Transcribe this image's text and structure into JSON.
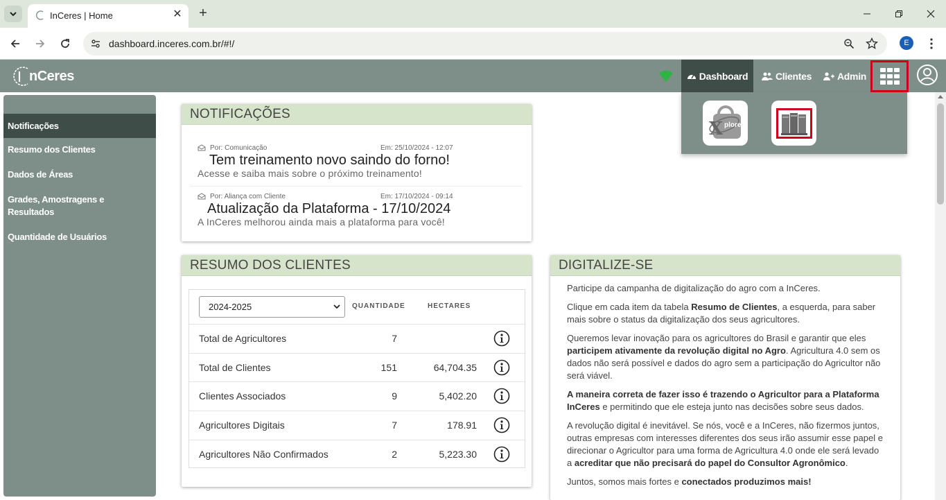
{
  "browser": {
    "tab_title": "InCeres | Home",
    "url": "dashboard.inceres.com.br/#!/",
    "profile_initial": "E"
  },
  "app": {
    "logo_text": "nCeres",
    "nav": {
      "dashboard": "Dashboard",
      "clientes": "Clientes",
      "admin": "Admin"
    },
    "apps": [
      "xplorer-app",
      "books-app"
    ],
    "xplorer_label": "plorer"
  },
  "sidebar": {
    "items": [
      {
        "label": "Notificações",
        "active": true
      },
      {
        "label": "Resumo dos Clientes"
      },
      {
        "label": "Dados de Áreas"
      },
      {
        "label": "Grades, Amostragens e Resultados"
      },
      {
        "label": "Quantidade de Usuários"
      }
    ]
  },
  "notifications": {
    "title": "NOTIFICAÇÕES",
    "items": [
      {
        "from": "Por: Comunicação",
        "date": "Em: 25/10/2024 - 12:07",
        "title": "Tem treinamento novo saindo do forno!",
        "desc": "Acesse e saiba mais sobre o próximo treinamento!"
      },
      {
        "from": "Por: Aliança com Cliente",
        "date": "Em: 17/10/2024 - 09:14",
        "title": "Atualização da Plataforma - 17/10/2024",
        "desc": "A InCeres melhorou ainda mais a plataforma para você!"
      }
    ]
  },
  "summary": {
    "title": "RESUMO DOS CLIENTES",
    "season": "2024-2025",
    "col_qty": "QUANTIDADE",
    "col_ha": "HECTARES",
    "rows": [
      {
        "label": "Total de Agricultores",
        "qty": "7",
        "ha": ""
      },
      {
        "label": "Total de Clientes",
        "qty": "151",
        "ha": "64,704.35"
      },
      {
        "label": "Clientes Associados",
        "qty": "9",
        "ha": "5,402.20"
      },
      {
        "label": "Agricultores Digitais",
        "qty": "7",
        "ha": "178.91"
      },
      {
        "label": "Agricultores Não Confirmados",
        "qty": "2",
        "ha": "5,223.30"
      }
    ]
  },
  "digitalize": {
    "title": "DIGITALIZE-SE",
    "p1": "Participe da campanha de digitalização do agro com a InCeres.",
    "p2a": "Clique em cada item da tabela ",
    "p2b": "Resumo de Clientes",
    "p2c": ", a esquerda, para saber mais sobre o status da digitalização dos seus agricultores.",
    "p3a": "Queremos levar inovação para os agricultores do Brasil e garantir que eles ",
    "p3b": "participem ativamente da revolução digital no Agro",
    "p3c": ". Agricultura 4.0 sem os dados não será possível e dados do agro sem a participação do Agricultor não será viável.",
    "p4a": "A maneira correta de fazer isso é trazendo o Agricultor para a Plataforma InCeres",
    "p4b": " e permitindo que ele esteja junto nas decisões sobre seus dados.",
    "p5a": "A revolução digital é inevitável. Se nós, você e a InCeres, não fizermos juntos, outras empresas com interesses diferentes dos seus irão assumir esse papel e direcionar o Agricultor para uma forma de Agricultura 4.0 onde ele será levado a ",
    "p5b": "acreditar que não precisará do papel do Consultor Agronômico",
    "p5c": ".",
    "p6a": "Juntos, somos mais fortes e ",
    "p6b": "conectados produzimos mais!"
  }
}
